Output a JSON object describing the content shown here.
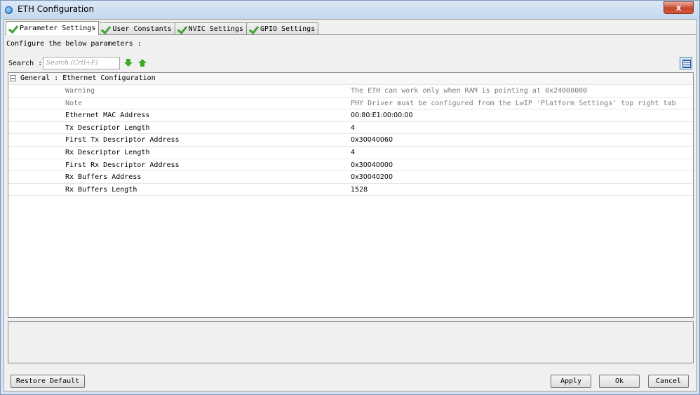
{
  "window": {
    "title": "ETH Configuration",
    "close_glyph": "x"
  },
  "tabs": [
    {
      "label": "Parameter Settings",
      "active": true
    },
    {
      "label": "User Constants",
      "active": false
    },
    {
      "label": "NVIC Settings",
      "active": false
    },
    {
      "label": "GPIO Settings",
      "active": false
    }
  ],
  "panel": {
    "configure_text": "Configure the below parameters :",
    "search_label": "Search :",
    "search_placeholder": "Search (Crtl+F)"
  },
  "grid": {
    "group_label": "General : Ethernet Configuration",
    "rows": [
      {
        "name": "Warning",
        "value": "The ETH can work only when RAM is pointing at 0x24000000"
      },
      {
        "name": "Note",
        "value": "PHY Driver must be configured from the LwIP 'Platform Settings' top right tab"
      },
      {
        "name": "Ethernet MAC Address",
        "value": "00:80:E1:00:00:00"
      },
      {
        "name": "Tx Descriptor Length",
        "value": "4"
      },
      {
        "name": "First Tx Descriptor Address",
        "value": "0x30040060"
      },
      {
        "name": "Rx Descriptor Length",
        "value": "4"
      },
      {
        "name": "First Rx Descriptor Address",
        "value": "0x30040000"
      },
      {
        "name": "Rx Buffers Address",
        "value": "0x30040200"
      },
      {
        "name": "Rx Buffers Length",
        "value": "1528"
      }
    ]
  },
  "buttons": {
    "restore_default": "Restore Default",
    "apply": "Apply",
    "ok": "Ok",
    "cancel": "Cancel"
  }
}
